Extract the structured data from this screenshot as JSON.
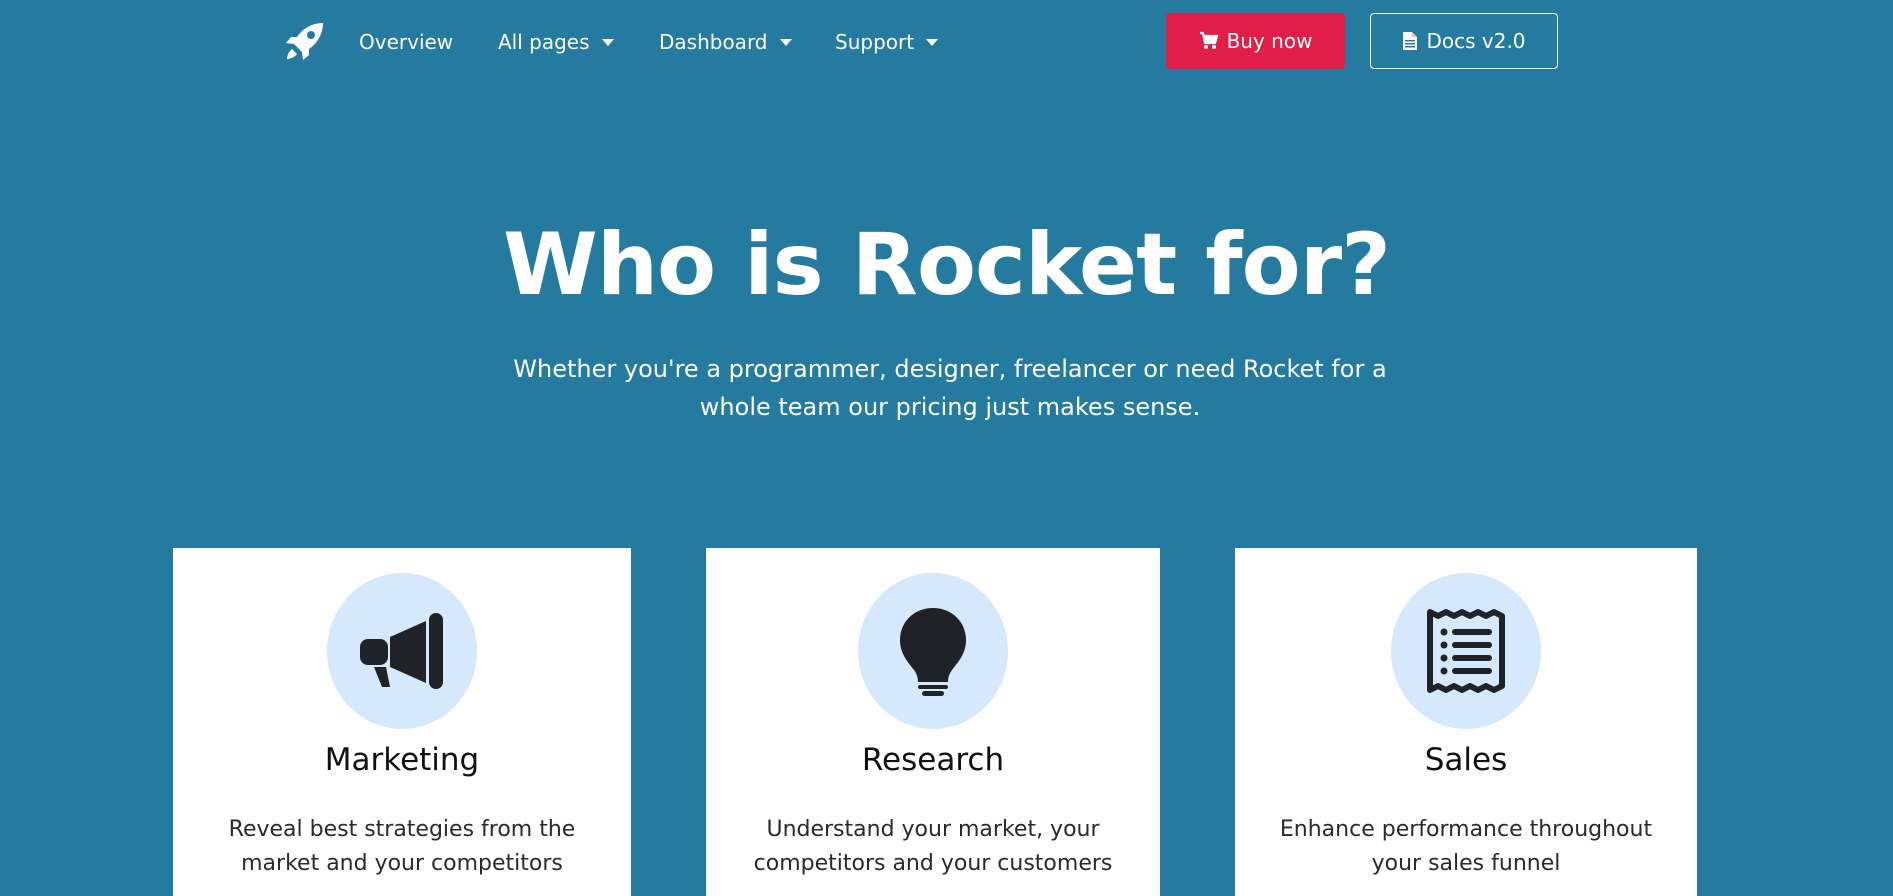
{
  "nav": {
    "brand_icon": "rocket-icon",
    "links": [
      {
        "label": "Overview"
      },
      {
        "label": "All pages"
      },
      {
        "label": "Dashboard"
      },
      {
        "label": "Support"
      }
    ],
    "buy_button": {
      "label": "Buy now",
      "icon": "cart-icon",
      "color": "#e11d48"
    },
    "docs_button": {
      "label": "Docs v2.0",
      "icon": "file-icon"
    }
  },
  "hero": {
    "title": "Who is Rocket for?",
    "subtitle": "Whether you're a programmer, designer, freelancer or need Rocket for a whole team our pricing just makes sense."
  },
  "cards": [
    {
      "title": "Marketing",
      "text": "Reveal best strategies from the market and your competitors",
      "icon": "megaphone-icon"
    },
    {
      "title": "Research",
      "text": "Understand your market, your competitors and your customers",
      "icon": "lightbulb-icon"
    },
    {
      "title": "Sales",
      "text": "Enhance performance throughout your sales funnel",
      "icon": "receipt-icon"
    }
  ],
  "colors": {
    "background": "#247b9f",
    "icon_circle": "#d6e8fb",
    "card": "#ffffff"
  }
}
